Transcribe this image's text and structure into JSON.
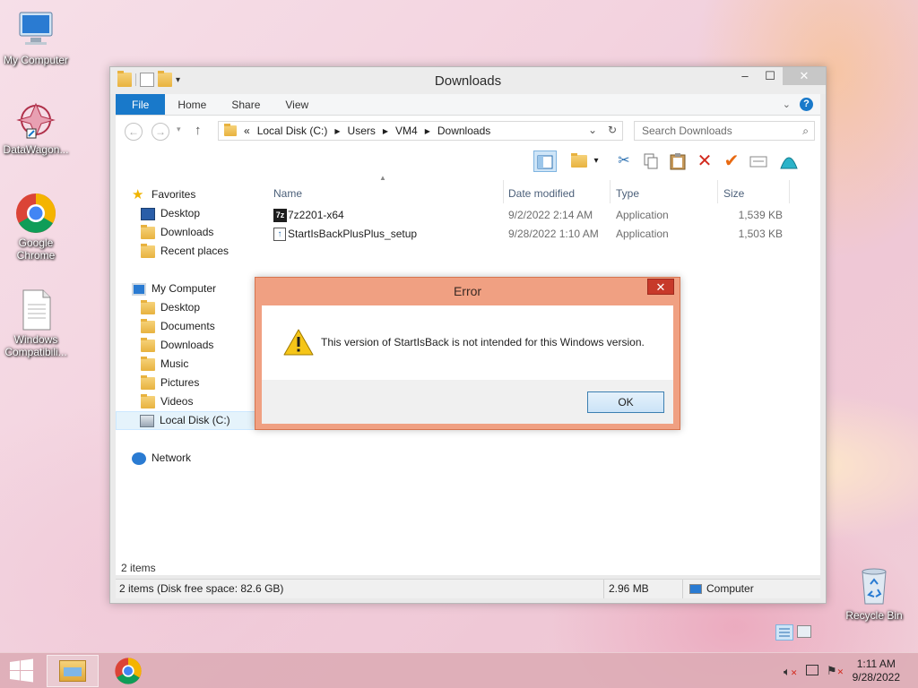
{
  "desktop": {
    "icons": [
      {
        "label": "My Computer"
      },
      {
        "label": "DataWagon..."
      },
      {
        "label": "Google Chrome"
      },
      {
        "label": "Windows Compatibili..."
      },
      {
        "label": "Recycle Bin"
      }
    ]
  },
  "explorer": {
    "title": "Downloads",
    "tabs": {
      "file": "File",
      "home": "Home",
      "share": "Share",
      "view": "View"
    },
    "address": {
      "prefix": "«",
      "crumbs": [
        "Local Disk (C:)",
        "Users",
        "VM4",
        "Downloads"
      ]
    },
    "search_placeholder": "Search Downloads",
    "nav": {
      "favorites": "Favorites",
      "fav_items": [
        "Desktop",
        "Downloads",
        "Recent places"
      ],
      "my_computer": "My Computer",
      "pc_items": [
        "Desktop",
        "Documents",
        "Downloads",
        "Music",
        "Pictures",
        "Videos",
        "Local Disk (C:)"
      ],
      "network": "Network"
    },
    "columns": {
      "name": "Name",
      "date": "Date modified",
      "type": "Type",
      "size": "Size"
    },
    "files": [
      {
        "name": "7z2201-x64",
        "date": "9/2/2022 2:14 AM",
        "type": "Application",
        "size": "1,539 KB"
      },
      {
        "name": "StartIsBackPlusPlus_setup",
        "date": "9/28/2022 1:10 AM",
        "type": "Application",
        "size": "1,503 KB"
      }
    ],
    "item_count": "2 items",
    "status": {
      "left": "2 items (Disk free space: 82.6 GB)",
      "size": "2.96 MB",
      "location": "Computer"
    }
  },
  "dialog": {
    "title": "Error",
    "message": "This version of StartIsBack is not intended for this Windows version.",
    "ok": "OK",
    "close": "✕"
  },
  "taskbar": {
    "time": "1:11 AM",
    "date": "9/28/2022"
  },
  "colors": {
    "accent": "#1979ca",
    "dialog_frame": "#f0a082",
    "dialog_close": "#c7392a"
  }
}
